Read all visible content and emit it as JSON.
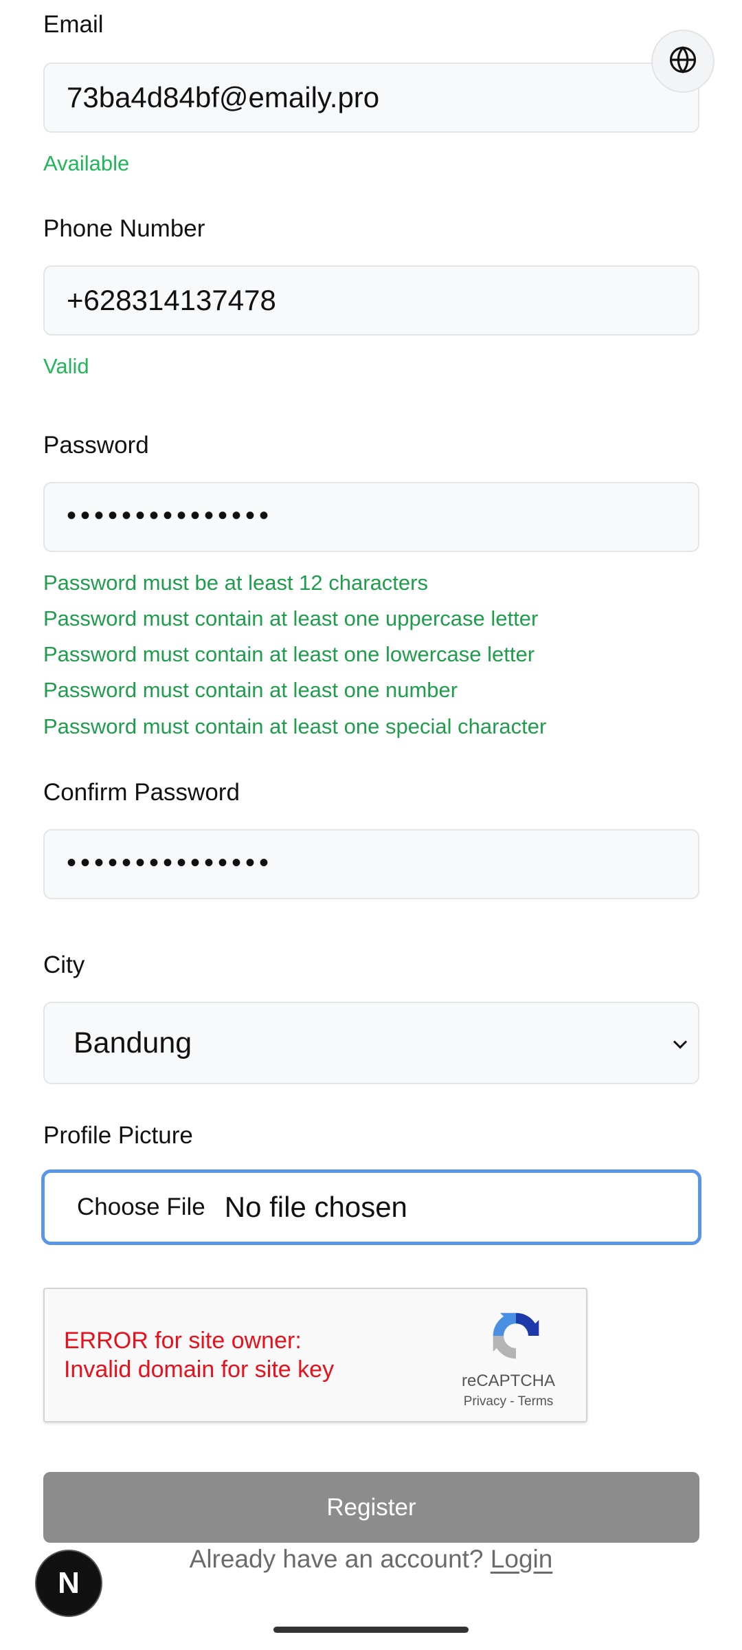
{
  "email": {
    "label": "Email",
    "value": "73ba4d84bf@emaily.pro",
    "status": "Available"
  },
  "phone": {
    "label": "Phone Number",
    "value": "+628314137478",
    "status": "Valid"
  },
  "password": {
    "label": "Password",
    "masked_value": "•••••••••••••••",
    "requirements": [
      "Password must be at least 12 characters",
      "Password must contain at least one uppercase letter",
      "Password must contain at least one lowercase letter",
      "Password must contain at least one number",
      "Password must contain at least one special character"
    ]
  },
  "confirm_password": {
    "label": "Confirm Password",
    "masked_value": "•••••••••••••••"
  },
  "city": {
    "label": "City",
    "selected": "Bandung"
  },
  "profile_picture": {
    "label": "Profile Picture",
    "choose_label": "Choose File",
    "status": "No file chosen"
  },
  "captcha": {
    "error_line1": "ERROR for site owner:",
    "error_line2": "Invalid domain for site key",
    "brand": "reCAPTCHA",
    "privacy": "Privacy",
    "separator": "-",
    "terms": "Terms"
  },
  "register_button": "Register",
  "login_prompt": {
    "text": "Already have an account?",
    "link": "Login"
  },
  "badge_letter": "N",
  "icons": {
    "language": "globe-icon",
    "select": "chevron-down-icon",
    "captcha": "recaptcha-logo-icon",
    "dev": "nextjs-badge-icon"
  },
  "colors": {
    "success": "#22b55a",
    "requirement": "#1f9d4c",
    "error": "#e8101a",
    "focus": "#5b95e6",
    "button_disabled": "#8c8c8c"
  }
}
